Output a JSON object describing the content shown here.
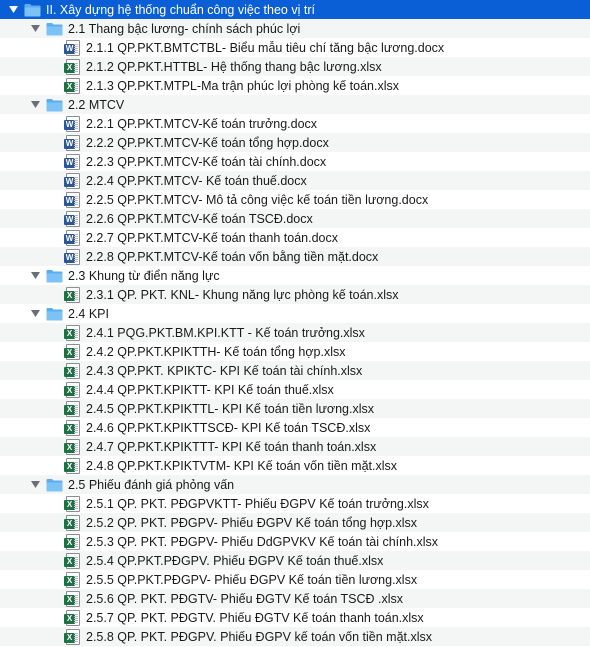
{
  "tree": {
    "root": {
      "label": "II. Xây dựng hệ thống chuẩn công việc theo vị trí",
      "icon": "folder-icon"
    },
    "groups": [
      {
        "label": "2.1 Thang bậc lương- chính sách phúc lợi",
        "files": [
          {
            "type": "word",
            "label": "2.1.1 QP.PKT.BMTCTBL- Biểu mẫu tiêu chí tăng bậc lương.docx"
          },
          {
            "type": "excel",
            "label": "2.1.2 QP.PKT.HTTBL- Hệ thống thang bậc lương.xlsx"
          },
          {
            "type": "excel",
            "label": "2.1.3 QP.PKT.MTPL-Ma trận phúc lợi phòng kế toán.xlsx"
          }
        ]
      },
      {
        "label": "2.2 MTCV",
        "files": [
          {
            "type": "word",
            "label": "2.2.1 QP.PKT.MTCV-Kế toán trưởng.docx"
          },
          {
            "type": "word",
            "label": "2.2.2 QP.PKT.MTCV-Kế toán tổng hợp.docx"
          },
          {
            "type": "word",
            "label": "2.2.3 QP.PKT.MTCV-Kế toán tài chính.docx"
          },
          {
            "type": "word",
            "label": "2.2.4 QP.PKT.MTCV- Kế toán thuế.docx"
          },
          {
            "type": "word",
            "label": "2.2.5 QP.PKT.MTCV- Mô tả công việc kế toán tiền lương.docx"
          },
          {
            "type": "word",
            "label": "2.2.6 QP.PKT.MTCV-Kế toán TSCĐ.docx"
          },
          {
            "type": "word",
            "label": "2.2.7 QP.PKT.MTCV-Kế toán thanh toán.docx"
          },
          {
            "type": "word",
            "label": "2.2.8 QP.PKT.MTCV-Kế toán vốn bằng tiền mặt.docx"
          }
        ]
      },
      {
        "label": "2.3 Khung từ điển năng lực",
        "files": [
          {
            "type": "excel",
            "label": "2.3.1 QP. PKT. KNL- Khung năng lực phòng kế toán.xlsx"
          }
        ]
      },
      {
        "label": "2.4 KPI",
        "files": [
          {
            "type": "excel",
            "label": "2.4.1 PQG.PKT.BM.KPI.KTT - Kế toán trưởng.xlsx"
          },
          {
            "type": "excel",
            "label": "2.4.2 QP.PKT.KPIKTTH- Kế toán tổng hợp.xlsx"
          },
          {
            "type": "excel",
            "label": "2.4.3 QP.PKT. KPIKTC- KPI Kế toán tài chính.xlsx"
          },
          {
            "type": "excel",
            "label": "2.4.4 QP.PKT.KPIKTT- KPI Kế toán thuế.xlsx"
          },
          {
            "type": "excel",
            "label": "2.4.5 QP.PKT.KPIKTTL- KPI Kế toán tiền lương.xlsx"
          },
          {
            "type": "excel",
            "label": "2.4.6 QP.PKT.KPIKTTSCĐ- KPI Kế toán TSCĐ.xlsx"
          },
          {
            "type": "excel",
            "label": "2.4.7 QP.PKT.KPIKTTT- KPI Kế toán thanh toán.xlsx"
          },
          {
            "type": "excel",
            "label": "2.4.8 QP.PKT.KPIKTVTM- KPI Kế toán vốn tiền mặt.xlsx"
          }
        ]
      },
      {
        "label": "2.5 Phiếu đánh giá phỏng vấn",
        "files": [
          {
            "type": "excel",
            "label": "2.5.1 QP. PKT. PĐGPVKTT- Phiếu ĐGPV Kế toán trưởng.xlsx"
          },
          {
            "type": "excel",
            "label": "2.5.2 QP. PKT. PĐGPV- Phiếu ĐGPV Kế toán tổng hợp.xlsx"
          },
          {
            "type": "excel",
            "label": "2.5.3 QP. PKT. PĐGPV- Phiếu DdGPVKV Kế toán tài chính.xlsx"
          },
          {
            "type": "excel",
            "label": "2.5.4 QP.PKT.PĐGPV. Phiếu ĐGPV Kế toán thuế.xlsx"
          },
          {
            "type": "excel",
            "label": "2.5.5 QP.PKT.PĐGPV- Phiếu ĐGPV Kế toán tiền lương.xlsx"
          },
          {
            "type": "excel",
            "label": "2.5.6 QP. PKT. PĐGTV- Phiếu ĐGTV Kế toán TSCĐ .xlsx"
          },
          {
            "type": "excel",
            "label": "2.5.7 QP. PKT. PĐGTV. Phiếu ĐGTV Kế toán thanh toán.xlsx"
          },
          {
            "type": "excel",
            "label": "2.5.8 QP. PKT. PĐGPV. Phiếu ĐGPV kế toán vốn tiền mặt.xlsx"
          }
        ]
      }
    ]
  },
  "icons": {
    "word_badge": "W",
    "excel_badge": "X"
  },
  "colors": {
    "selection": "#0b5fd6",
    "folder": "#5aaef0",
    "word": "#2b5797",
    "excel": "#1e7145"
  }
}
